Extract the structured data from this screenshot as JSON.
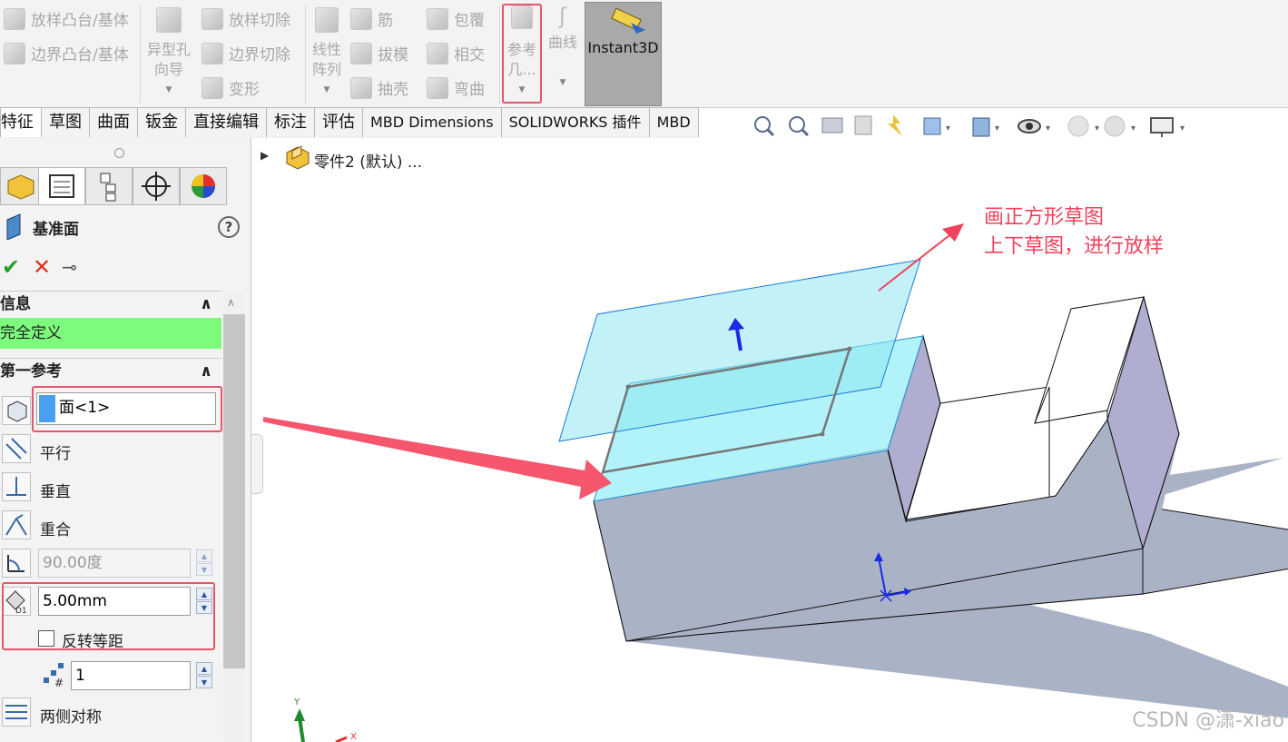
{
  "ribbon": {
    "loft_boss": "放样凸台/基体",
    "boundary_boss": "边界凸台/基体",
    "hole_wizard": [
      "异型孔",
      "向导"
    ],
    "loft_cut": "放样切除",
    "boundary_cut": "边界切除",
    "deform": "变形",
    "linear_pattern": [
      "线性",
      "阵列"
    ],
    "rib": "筋",
    "draft": "拔模",
    "shell": "抽壳",
    "wrap": "包覆",
    "intersect": "相交",
    "flex": "弯曲",
    "ref_geometry": [
      "参考",
      "几..."
    ],
    "curves": "曲线",
    "instant3d": "Instant3D"
  },
  "tabs": [
    "特征",
    "草图",
    "曲面",
    "钣金",
    "直接编辑",
    "标注",
    "评估",
    "MBD Dimensions",
    "SOLIDWORKS 插件",
    "MBD"
  ],
  "tree": {
    "part_label": "零件2 (默认) ..."
  },
  "panel": {
    "title": "基准面",
    "help": "?",
    "confirm": "✔",
    "cancel": "✕",
    "pin": "⊸",
    "info_header": "信息",
    "status": "完全定义",
    "first_ref_header": "第一参考",
    "ref_value": "面<1>",
    "parallel": "平行",
    "perpendicular": "垂直",
    "coincident": "重合",
    "angle_value": "90.00度",
    "offset_value": "5.00mm",
    "flip_offset": "反转等距",
    "instances_value": "1",
    "mid_plane": "两侧对称",
    "collapse": "∧"
  },
  "annotation": {
    "line1": "画正方形草图",
    "line2": "上下草图，进行放样"
  },
  "triad": {
    "x": "X",
    "y": "Y"
  },
  "watermark": "CSDN @潇-xiao",
  "colors": {
    "highlight": "#e8546b",
    "status_bg": "#7dfb7d",
    "plane": "#8fe8f0",
    "body_side": "#aab2c6"
  }
}
